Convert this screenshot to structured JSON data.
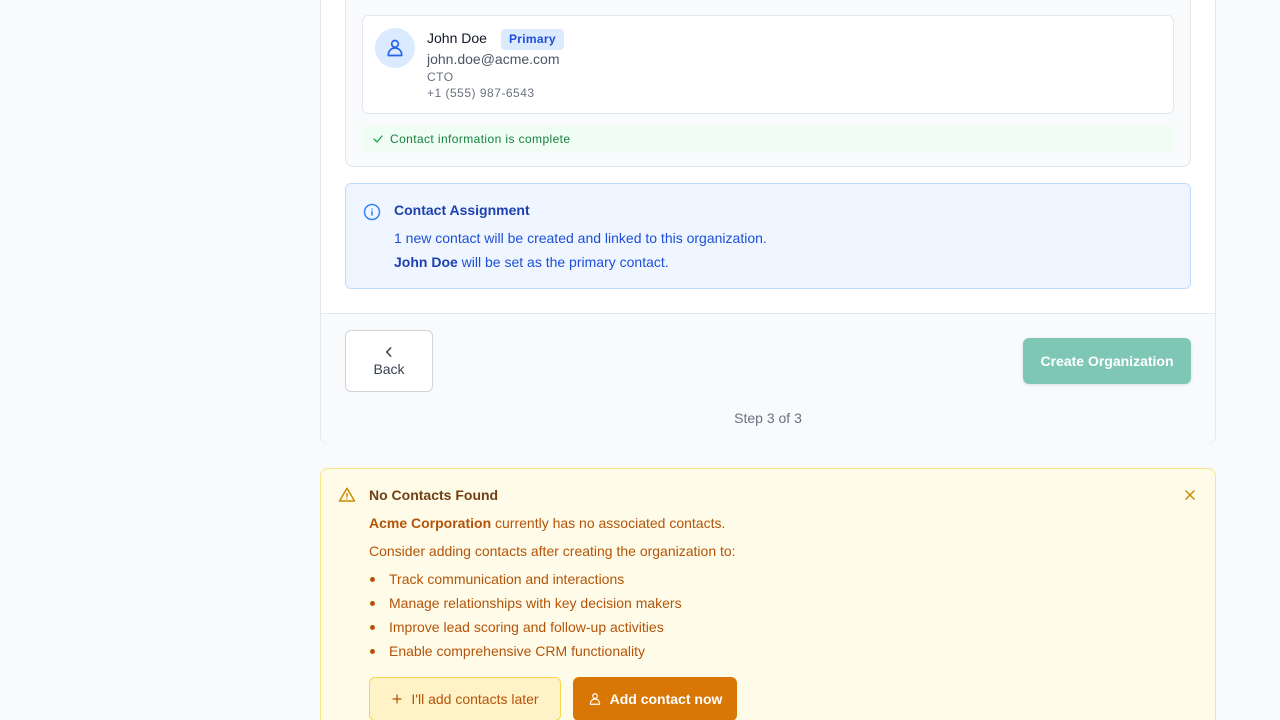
{
  "contact": {
    "name": "John Doe",
    "badge": "Primary",
    "email": "john.doe@acme.com",
    "title": "CTO",
    "phone": "+1 (555) 987-6543",
    "icon": "user-icon"
  },
  "completion": {
    "message": "Contact information is complete",
    "icon": "check-icon"
  },
  "assignment": {
    "title": "Contact Assignment",
    "line1": "1 new contact will be created and linked to this organization.",
    "line2_name": "John Doe",
    "line2_rest": " will be set as the primary contact.",
    "icon": "info-icon"
  },
  "footer": {
    "back_label": "Back",
    "create_label": "Create Organization",
    "step_text": "Step 3 of 3"
  },
  "warning": {
    "title": "No Contacts Found",
    "org_name": "Acme Corporation",
    "line1_rest": " currently has no associated contacts.",
    "line2": "Consider adding contacts after creating the organization to:",
    "items": [
      "Track communication and interactions",
      "Manage relationships with key decision makers",
      "Improve lead scoring and follow-up activities",
      "Enable comprehensive CRM functionality"
    ],
    "later_label": "I'll add contacts later",
    "add_label": "Add contact now",
    "icon": "warning-icon"
  },
  "colors": {
    "accent_blue": "#1d4ed8",
    "success_green": "#15803d",
    "create_button": "#7fc7b5",
    "warning_amber": "#d97706"
  }
}
